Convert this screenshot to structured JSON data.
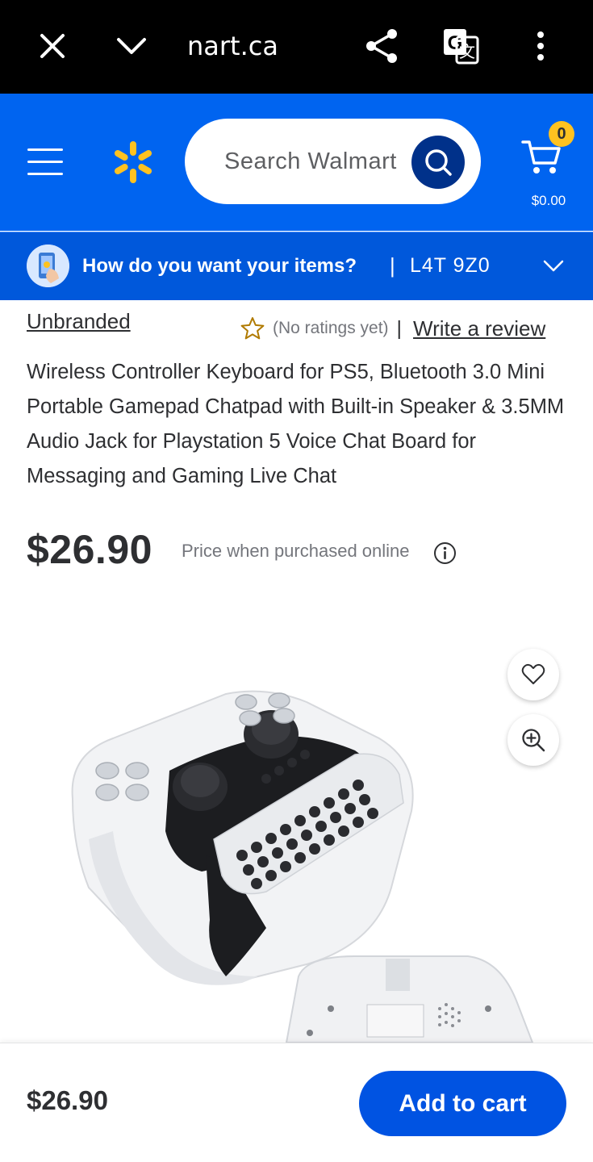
{
  "browser": {
    "url_fragment": "nart.ca",
    "icons": [
      "close-icon",
      "chevron-down-icon",
      "share-icon",
      "translate-icon",
      "more-vertical-icon"
    ]
  },
  "header": {
    "search_placeholder": "Search Walmart",
    "cart_count": "0",
    "cart_total": "$0.00",
    "brand_blue": "#0064f0",
    "spark_yellow": "#ffc220"
  },
  "delivery": {
    "question": "How do you want your items?",
    "separator": "|",
    "postal_code": "L4T 9Z0"
  },
  "product": {
    "brand": "Unbranded",
    "ratings_text": "(No ratings yet)",
    "ratings_separator": "|",
    "write_review": "Write a review",
    "title": "Wireless Controller Keyboard for PS5, Bluetooth 3.0 Mini Portable Gamepad Chatpad with Built-in Speaker & 3.5MM Audio Jack for Playstation 5 Voice Chat Board for Messaging and Gaming Live Chat",
    "price": "$26.90",
    "price_note": "Price when purchased online"
  },
  "bottom_bar": {
    "price": "$26.90",
    "add_to_cart": "Add to cart"
  }
}
